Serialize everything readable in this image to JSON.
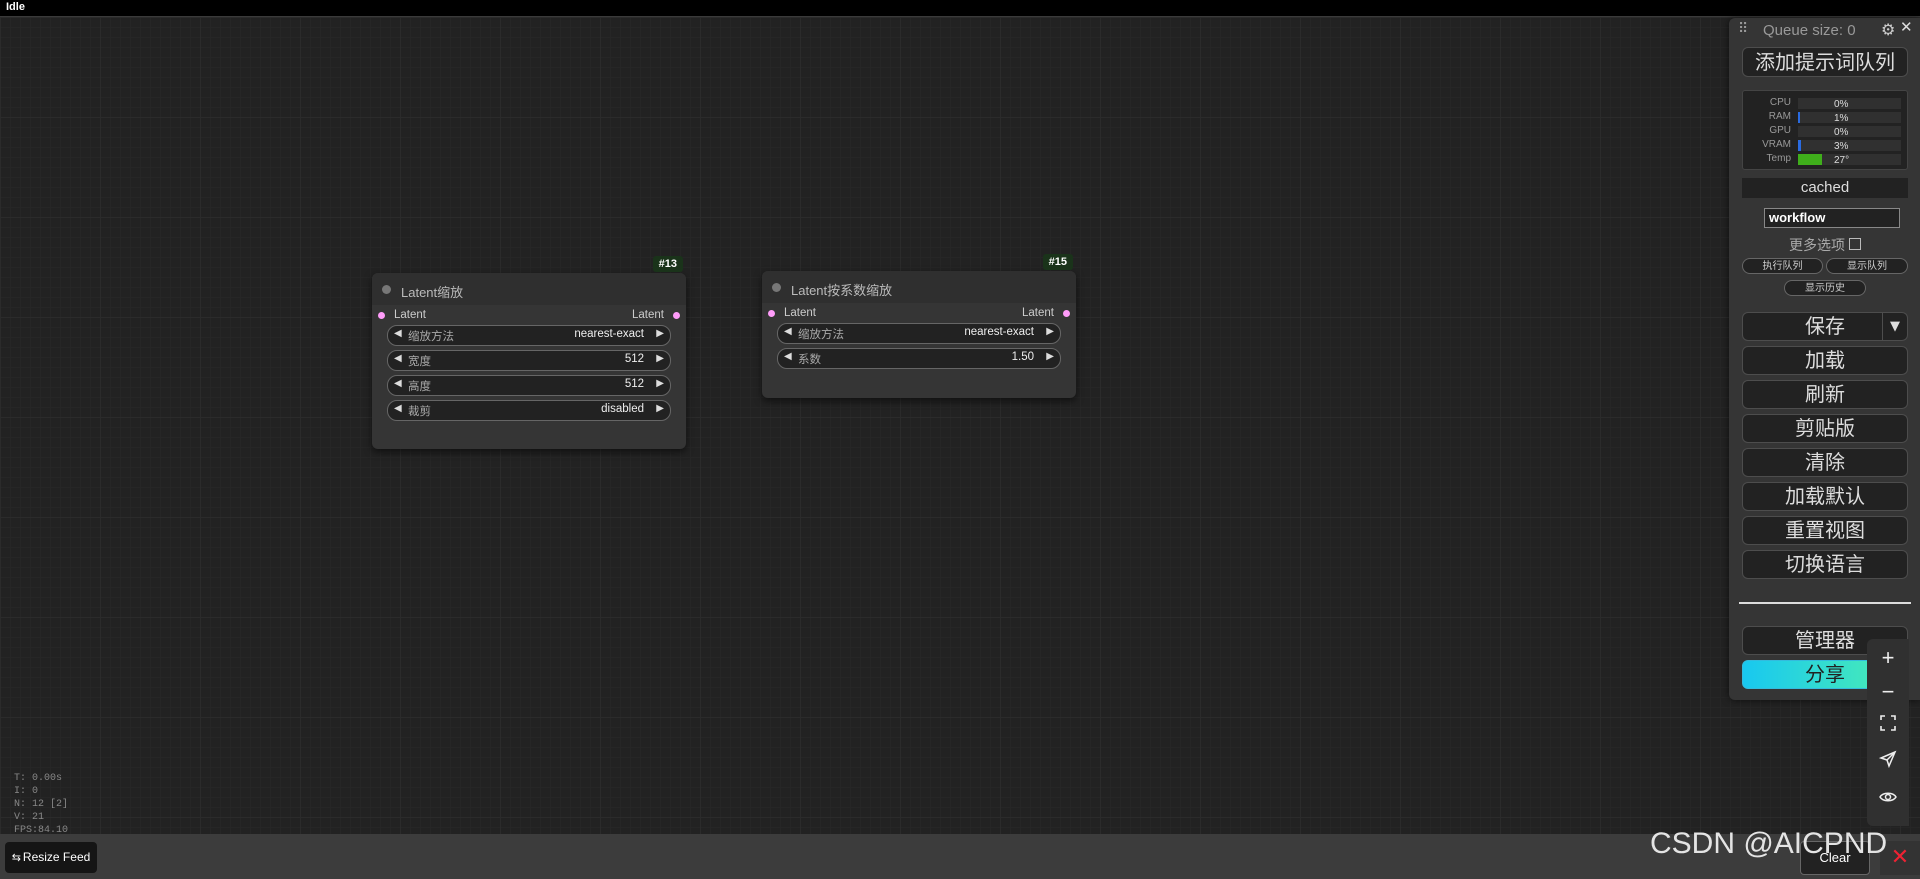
{
  "status": {
    "label": "Idle"
  },
  "nodes": [
    {
      "id": "#13",
      "title": "Latent缩放",
      "input": "Latent",
      "output": "Latent",
      "widgets": [
        {
          "name": "缩放方法",
          "value": "nearest-exact"
        },
        {
          "name": "宽度",
          "value": "512"
        },
        {
          "name": "高度",
          "value": "512"
        },
        {
          "name": "裁剪",
          "value": "disabled"
        }
      ]
    },
    {
      "id": "#15",
      "title": "Latent按系数缩放",
      "input": "Latent",
      "output": "Latent",
      "widgets": [
        {
          "name": "缩放方法",
          "value": "nearest-exact"
        },
        {
          "name": "系数",
          "value": "1.50"
        }
      ]
    }
  ],
  "panel": {
    "queue_size": "Queue size: 0",
    "queue_prompt": "添加提示词队列",
    "monitor": [
      {
        "label": "CPU",
        "value": "0%",
        "fill": 0.0,
        "color": "#2a6be0"
      },
      {
        "label": "RAM",
        "value": "1%",
        "fill": 0.01,
        "color": "#2a6be0"
      },
      {
        "label": "GPU",
        "value": "0%",
        "fill": 0.0,
        "color": "#2a6be0"
      },
      {
        "label": "VRAM",
        "value": "3%",
        "fill": 0.03,
        "color": "#2a6be0"
      },
      {
        "label": "Temp",
        "value": "27°",
        "fill": 0.27,
        "color": "#3fae1b"
      }
    ],
    "cached": "cached",
    "workflow_value": "workflow",
    "more_options": "更多选项",
    "exec_queue": "执行队列",
    "show_queue": "显示队列",
    "show_history": "显示历史",
    "save": "保存",
    "save_arrow": "▼",
    "load": "加载",
    "refresh": "刷新",
    "clipspace": "剪贴版",
    "clear": "清除",
    "load_default": "加载默认",
    "reset_view": "重置视图",
    "switch_language": "切换语言",
    "manager": "管理器",
    "share": "分享"
  },
  "stats": {
    "t": "T: 0.00s",
    "i": "I: 0",
    "n": "N: 12 [2]",
    "v": "V: 21",
    "fps": "FPS:84.10"
  },
  "bottom": {
    "resize_feed": "Resize Feed",
    "clear": "Clear",
    "watermark": "CSDN @AICPND"
  }
}
